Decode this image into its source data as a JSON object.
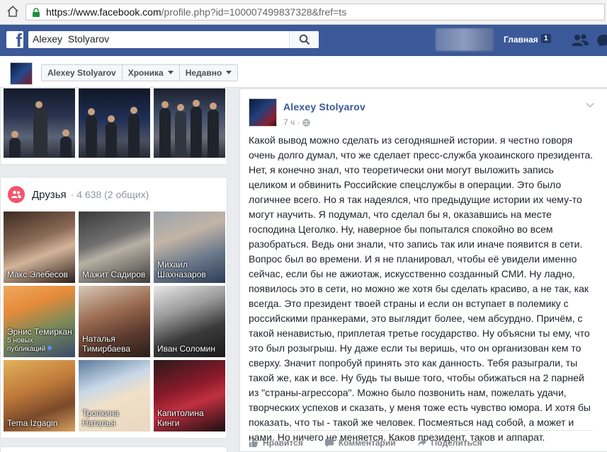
{
  "browser": {
    "url_host": "https://www.facebook.com",
    "url_rest": "/profile.php?id=100007499837328&fref=ts"
  },
  "topbar": {
    "search_value": "Alexey  Stolyarov",
    "home_label": "Главная",
    "home_count": "1"
  },
  "profile_bar": {
    "name": "Alexey Stolyarov",
    "timeline": "Хроника",
    "recent": "Недавно"
  },
  "friends": {
    "title": "Друзья",
    "count": "· 4 638 (2 общих)",
    "items": [
      {
        "name": "Макс Элебесов",
        "sub": ""
      },
      {
        "name": "Мажит Садиров",
        "sub": ""
      },
      {
        "name": "Михаил Шахназаров",
        "sub": ""
      },
      {
        "name": "Эрнис Темиркан",
        "sub": "5 новых публикаций"
      },
      {
        "name": "Наталья Тимирбаева",
        "sub": ""
      },
      {
        "name": "Иван Соломин",
        "sub": ""
      },
      {
        "name": "Tema Izgagin",
        "sub": ""
      },
      {
        "name": "Тропкина Наталья",
        "sub": ""
      },
      {
        "name": "Капитолина Кинги",
        "sub": ""
      }
    ]
  },
  "post": {
    "author": "Alexey Stolyarov",
    "time": "7 ч ·",
    "text": "Какой вывод можно сделать из сегодняшней истории. я честно говоря очень долго думал, что же сделает пресс-служба укоаинского президента. Нет, я конечно знал, что теоретически они могут выложить запись целиком и обвинить Российские спецслужбы в операции. Это было логичнее всего. Но я так надеялся, что предыдущие истории их чему-то могут научить. Я подумал, что сделал бы я, оказавшись на месте господина Цеголко. Ну, наверное бы попытался спокойно во всем разобраться. Ведь они знали, что запись так или иначе появится в сети. Вопрос был во времени. И я не планировал, чтобы её увидели именно сейчас, если бы не ажиотаж, искусственно созданный СМИ. Ну ладно, появилось это в сети, но можно же хотя бы сделать красиво, а не так, как всегда. Это президент твоей страны и если он вступает в полемику с российскими пранкерами, это выглядит более, чем абсурдно. Причём, с такой ненавистью, приплетая третье государство. Ну объясни ты ему, что это был розыгрыш. Ну даже если ты веришь, что он организован кем то сверху. Значит попробуй принять это как данность. Тебя разыграли, ты такой же, как и все. Ну будь ты выше того, чтобы обижаться на 2 парней из \"страны-агрессора\". Можно было позвонить нам, пожелать удачи, творческих успехов и сказать, у меня тоже есть чувство юмора. И хотя бы показать, что ты - такой же человек. Посмеяться над собой, а может и нами. Но ничего не меняется. Каков президент, таков и аппарат.",
    "actions": {
      "like": "Нравится",
      "comment": "Комментарий",
      "share": "Поделиться"
    }
  },
  "colors": {
    "fb_blue": "#3b5998",
    "link": "#365899",
    "page_bg": "#e9ebee",
    "friends_badge": "#f5536c"
  }
}
